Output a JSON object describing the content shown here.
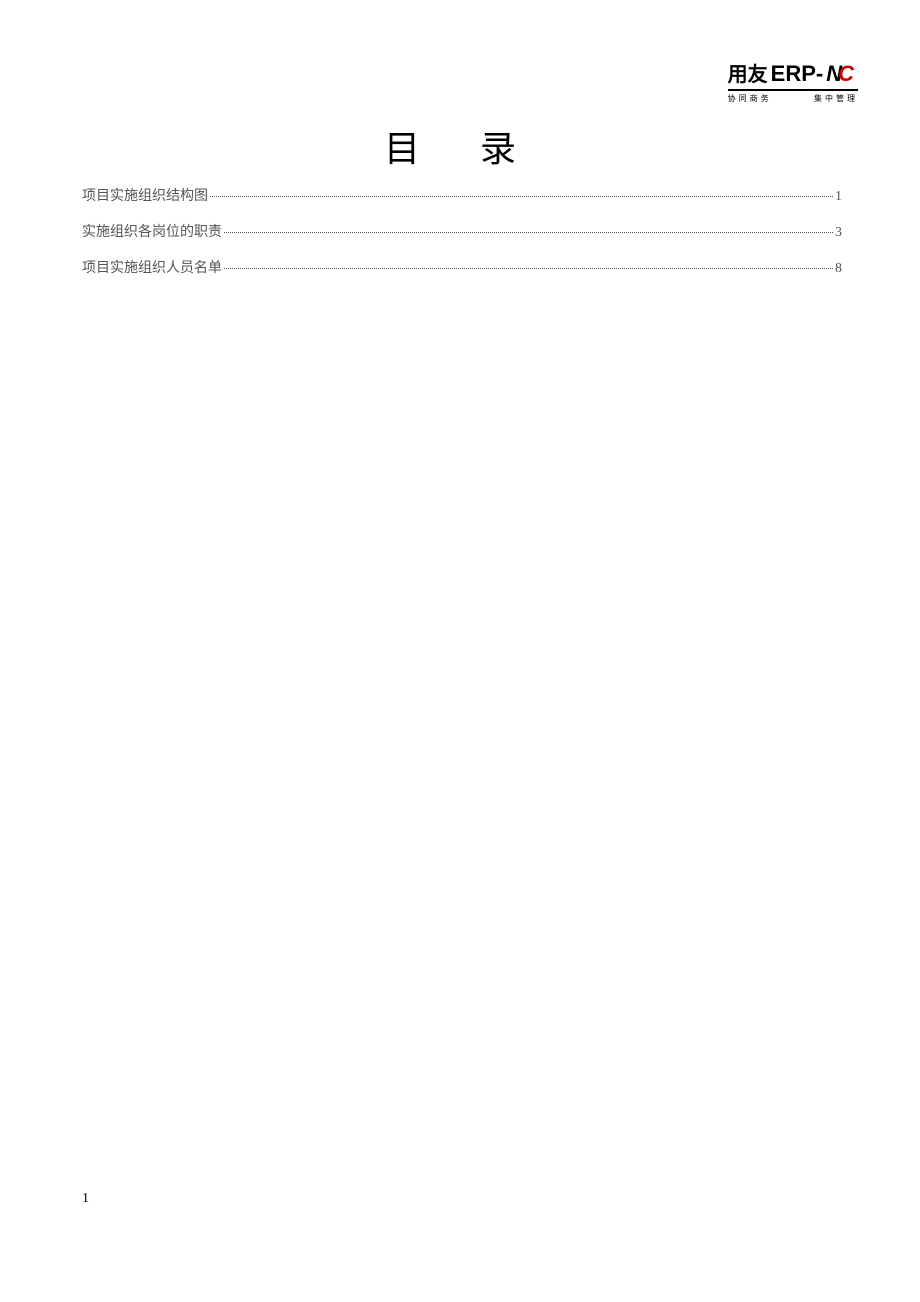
{
  "logo": {
    "cn": "用友",
    "erp": "ERP-",
    "n": "N",
    "c": "C",
    "sub_left": "协同商务",
    "sub_right": "集中管理"
  },
  "title": {
    "char1": "目",
    "char2": "录"
  },
  "toc": [
    {
      "label": "项目实施组织结构图",
      "page": "1"
    },
    {
      "label": "实施组织各岗位的职责",
      "page": "3"
    },
    {
      "label": "项目实施组织人员名单",
      "page": "8"
    }
  ],
  "page_number": "1"
}
